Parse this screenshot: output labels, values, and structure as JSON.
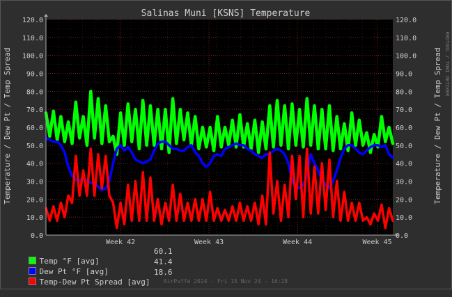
{
  "chart_data": {
    "type": "line",
    "title": "Salinas Muni [KSNS] Temperature",
    "ylabel": "Temperature / Dew Pt / Temp Spread",
    "ylim": [
      0,
      120
    ],
    "yticks": [
      "0.0",
      "10.0",
      "20.0",
      "30.0",
      "40.0",
      "50.0",
      "60.0",
      "70.0",
      "80.0",
      "90.0",
      "100.0",
      "110.0",
      "120.0"
    ],
    "xticks": [
      "Week 42",
      "Week 43",
      "Week 44",
      "Week 45"
    ],
    "grid": true,
    "series": [
      {
        "name": "Temp °F [avg]",
        "color": "#00ff00",
        "summary": "60.1",
        "values": [
          68,
          55,
          69,
          53,
          66,
          52,
          63,
          51,
          74,
          54,
          66,
          50,
          80,
          54,
          76,
          51,
          72,
          52,
          55,
          45,
          68,
          50,
          73,
          52,
          70,
          48,
          75,
          50,
          72,
          50,
          70,
          48,
          70,
          46,
          76,
          51,
          70,
          53,
          68,
          50,
          66,
          48,
          60,
          49,
          60,
          47,
          66,
          49,
          60,
          50,
          64,
          49,
          67,
          49,
          62,
          48,
          64,
          46,
          63,
          48,
          72,
          49,
          75,
          50,
          72,
          48,
          73,
          50,
          70,
          49,
          76,
          50,
          72,
          48,
          70,
          48,
          72,
          47,
          66,
          48,
          62,
          47,
          68,
          50,
          64,
          50,
          57,
          46,
          56,
          49,
          66,
          52,
          60,
          51
        ]
      },
      {
        "name": "Dew Pt °F [avg]",
        "color": "#0000ff",
        "summary": "41.4",
        "values": [
          54,
          53,
          52,
          52,
          50,
          46,
          38,
          33,
          31,
          30,
          32,
          30,
          29,
          29,
          27,
          25,
          26,
          30,
          40,
          48,
          50,
          47,
          49,
          46,
          42,
          41,
          40,
          41,
          42,
          47,
          51,
          52,
          52,
          50,
          48,
          48,
          47,
          47,
          49,
          50,
          46,
          44,
          40,
          38,
          40,
          44,
          45,
          44,
          48,
          49,
          50,
          51,
          50,
          50,
          48,
          47,
          45,
          44,
          43,
          45,
          45,
          47,
          48,
          47,
          45,
          40,
          30,
          27,
          26,
          28,
          33,
          45,
          40,
          36,
          30,
          28,
          26,
          30,
          36,
          43,
          48,
          50,
          50,
          48,
          46,
          45,
          47,
          49,
          50,
          50,
          49,
          50,
          45,
          43
        ]
      },
      {
        "name": "Temp-Dew Pt Spread [avg]",
        "color": "#ff0000",
        "summary": "18.6",
        "values": [
          15,
          8,
          16,
          8,
          18,
          10,
          22,
          18,
          44,
          22,
          36,
          22,
          48,
          22,
          45,
          26,
          44,
          22,
          18,
          4,
          18,
          6,
          28,
          8,
          30,
          8,
          35,
          8,
          32,
          8,
          20,
          6,
          18,
          8,
          28,
          8,
          23,
          8,
          18,
          8,
          20,
          8,
          20,
          8,
          24,
          8,
          15,
          8,
          14,
          8,
          16,
          8,
          18,
          8,
          16,
          8,
          18,
          6,
          22,
          6,
          46,
          12,
          30,
          8,
          28,
          10,
          44,
          20,
          44,
          10,
          48,
          12,
          38,
          12,
          40,
          14,
          42,
          10,
          30,
          8,
          24,
          8,
          18,
          8,
          18,
          8,
          10,
          6,
          12,
          8,
          17,
          4,
          15,
          8
        ]
      }
    ]
  },
  "legend": {
    "temp_label": "Temp °F [avg]",
    "dew_label": "Dew Pt °F [avg]",
    "spread_label": "Temp-Dew Pt Spread [avg]",
    "temp_value": "60.1",
    "dew_value": "41.4",
    "spread_value": "18.6"
  },
  "watermark": "RRDTOOL / TOBI OETIKER",
  "footer": "AirPuffe 2024 - Fri 15 Nov 24 - 16:28"
}
